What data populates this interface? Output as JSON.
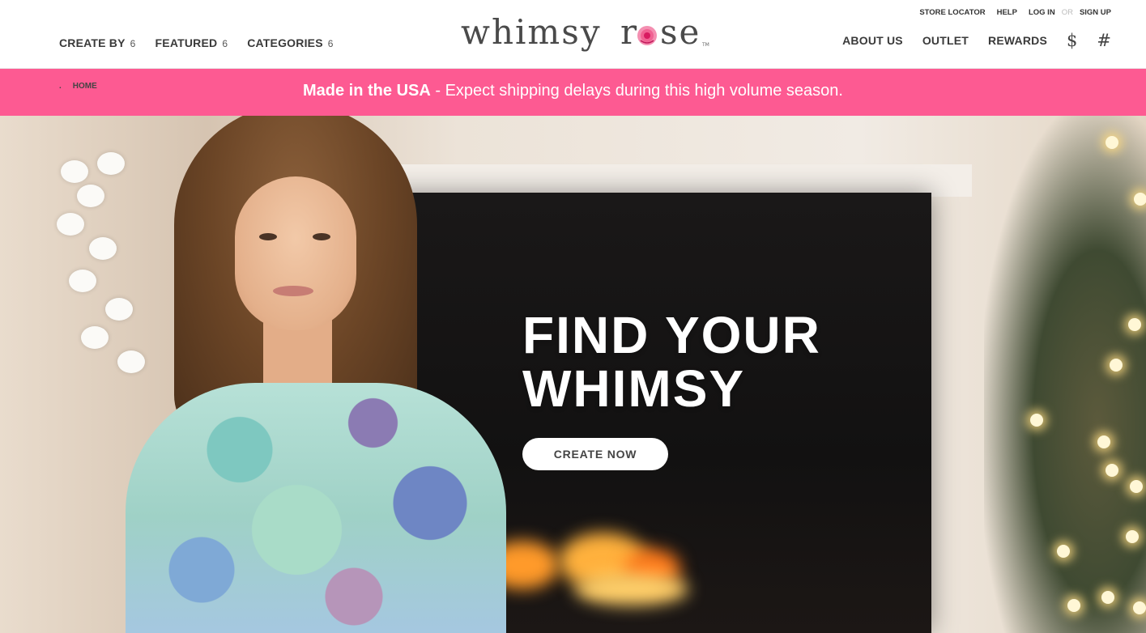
{
  "header": {
    "nav_left": [
      {
        "label": "CREATE BY",
        "count": "6"
      },
      {
        "label": "FEATURED",
        "count": "6"
      },
      {
        "label": "CATEGORIES",
        "count": "6"
      }
    ],
    "logo": {
      "text_left": "whimsy",
      "text_right": "r",
      "text_right_end": "se",
      "tm": "TM"
    },
    "utility": {
      "store_locator": "STORE LOCATOR",
      "help": "HELP",
      "log_in": "LOG IN",
      "or": "OR",
      "sign_up": "SIGN UP"
    },
    "nav_right": [
      {
        "label": "ABOUT US"
      },
      {
        "label": "OUTLET"
      },
      {
        "label": "REWARDS"
      }
    ],
    "currency_icon": "$",
    "cart_icon": "#"
  },
  "promo": {
    "breadcrumb_dot": ".",
    "breadcrumb_home": "HOME",
    "bold": "Made in the USA",
    "rest": " - Expect shipping delays during this high volume season."
  },
  "hero": {
    "title_line1": "FIND YOUR",
    "title_line2": "WHIMSY",
    "cta_label": "CREATE NOW"
  },
  "colors": {
    "promo_bg": "#fd5a92",
    "accent_rose": "#f06292"
  }
}
